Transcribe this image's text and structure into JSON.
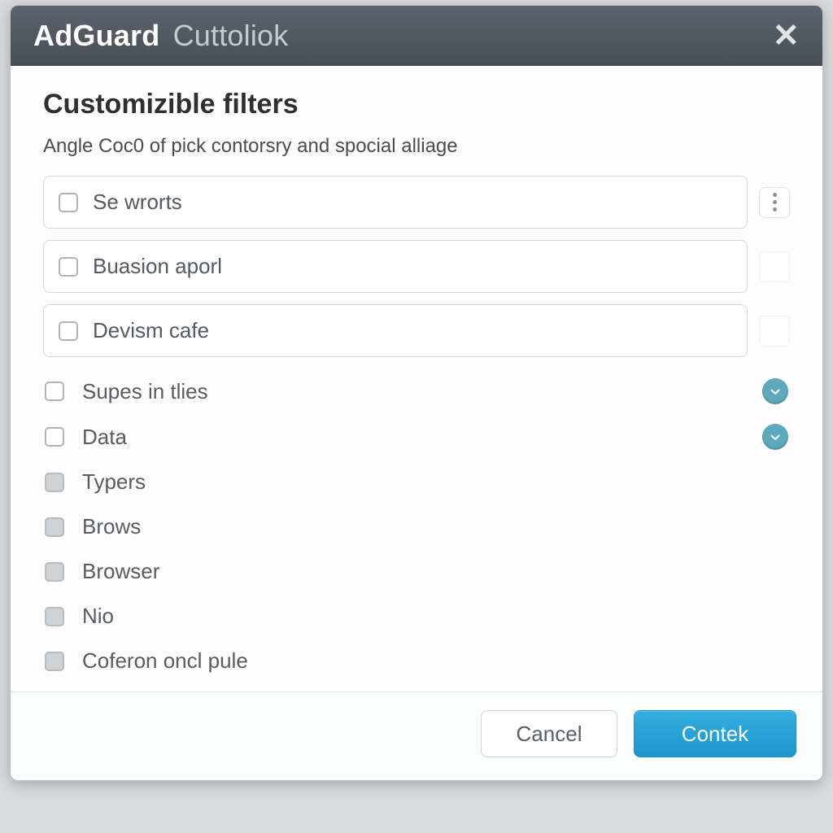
{
  "titlebar": {
    "app_name": "AdGuard",
    "subtitle": "Cuttoliok",
    "close_glyph": "✕"
  },
  "section": {
    "heading": "Customizible filters",
    "description": "Angle Coc0 of pick contorsry and spocial alliage"
  },
  "boxed_filters": [
    {
      "label": "Se wrorts"
    },
    {
      "label": "Buasion aporl"
    },
    {
      "label": "Devism cafe"
    }
  ],
  "plain_filters": [
    {
      "label": "Supes in tlies",
      "checkbox_style": "empty",
      "has_badge": true
    },
    {
      "label": "Data",
      "checkbox_style": "empty",
      "has_badge": true
    },
    {
      "label": "Typers",
      "checkbox_style": "grey",
      "has_badge": false
    },
    {
      "label": "Brows",
      "checkbox_style": "grey",
      "has_badge": false
    },
    {
      "label": "Browser",
      "checkbox_style": "grey",
      "has_badge": false
    },
    {
      "label": "Nio",
      "checkbox_style": "grey",
      "has_badge": false
    },
    {
      "label": "Coferon oncl pule",
      "checkbox_style": "grey",
      "has_badge": false
    }
  ],
  "footer": {
    "cancel_label": "Cancel",
    "confirm_label": "Contek"
  },
  "colors": {
    "accent": "#1d97cc",
    "titlebar_top": "#5b636c",
    "titlebar_bottom": "#474e56",
    "badge": "#5fa9bf"
  }
}
